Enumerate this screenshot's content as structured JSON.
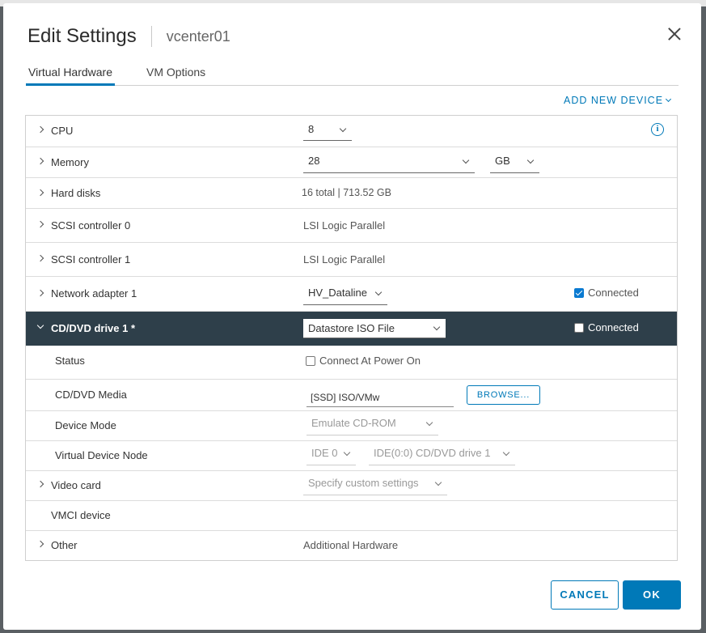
{
  "dialog": {
    "title": "Edit Settings",
    "subtitle": "vcenter01",
    "tabs": [
      {
        "label": "Virtual Hardware",
        "active": true
      },
      {
        "label": "VM Options",
        "active": false
      }
    ],
    "add_device_label": "ADD NEW DEVICE",
    "cancel_label": "CANCEL",
    "ok_label": "OK"
  },
  "hardware": {
    "cpu": {
      "label": "CPU",
      "value": "8"
    },
    "memory": {
      "label": "Memory",
      "value": "28",
      "unit": "GB"
    },
    "hard_disks": {
      "label": "Hard disks",
      "value": "16 total | 713.52 GB"
    },
    "scsi0": {
      "label": "SCSI controller 0",
      "value": "LSI Logic Parallel"
    },
    "scsi1": {
      "label": "SCSI controller 1",
      "value": "LSI Logic Parallel"
    },
    "network": {
      "label": "Network adapter 1",
      "value": "HV_Dataline",
      "connected_label": "Connected",
      "connected": true
    },
    "cdvd": {
      "label": "CD/DVD drive 1 *",
      "value": "Datastore ISO File",
      "connected_label": "Connected",
      "connected": false,
      "status_label": "Status",
      "status_option": "Connect At Power On",
      "media_label": "CD/DVD Media",
      "media_value": "[SSD] ISO/VMw",
      "browse_label": "BROWSE...",
      "mode_label": "Device Mode",
      "mode_value": "Emulate CD-ROM",
      "node_label": "Virtual Device Node",
      "node_bus": "IDE 0",
      "node_slot": "IDE(0:0) CD/DVD drive 1"
    },
    "video": {
      "label": "Video card",
      "value": "Specify custom settings"
    },
    "vmci": {
      "label": "VMCI device"
    },
    "other": {
      "label": "Other",
      "value": "Additional Hardware"
    }
  },
  "colors": {
    "accent": "#0079b8",
    "selected_row": "#2e3f4a"
  }
}
